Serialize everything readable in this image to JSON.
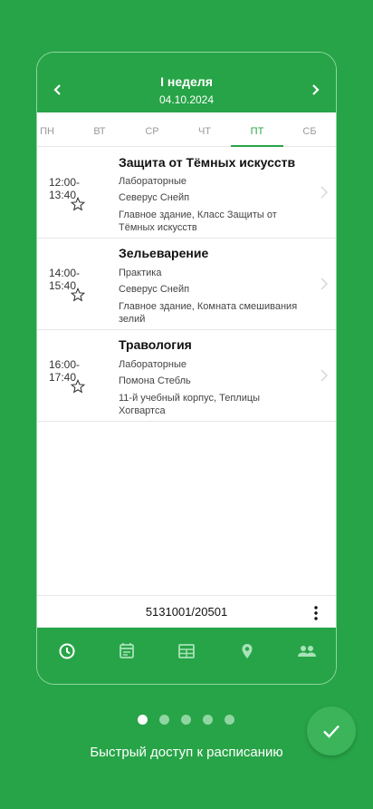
{
  "header": {
    "week_title": "I неделя",
    "date": "04.10.2024"
  },
  "days": [
    {
      "label": "ПН",
      "active": false
    },
    {
      "label": "ВТ",
      "active": false
    },
    {
      "label": "СР",
      "active": false
    },
    {
      "label": "ЧТ",
      "active": false
    },
    {
      "label": "ПТ",
      "active": true
    },
    {
      "label": "СБ",
      "active": false
    }
  ],
  "lessons": [
    {
      "time": "12:00-13:40",
      "subject": "Защита от Тёмных искусств",
      "type": "Лабораторные",
      "teacher": "Северус Снейп",
      "location": "Главное здание, Класс Защиты от Тёмных искусств"
    },
    {
      "time": "14:00-15:40",
      "subject": "Зельеварение",
      "type": "Практика",
      "teacher": "Северус Снейп",
      "location": "Главное здание, Комната смешивания зелий"
    },
    {
      "time": "16:00-17:40",
      "subject": "Травология",
      "type": "Лабораторные",
      "teacher": "Помона Стебль",
      "location": "11-й учебный корпус, Теплицы Хогвартса"
    }
  ],
  "group_code": "5131001/20501",
  "tabs": [
    {
      "icon": "clock-icon",
      "active": true
    },
    {
      "icon": "calendar-icon",
      "active": false
    },
    {
      "icon": "table-icon",
      "active": false
    },
    {
      "icon": "map-pin-icon",
      "active": false
    },
    {
      "icon": "people-icon",
      "active": false
    }
  ],
  "onboarding": {
    "caption": "Быстрый доступ к расписанию",
    "page_count": 5,
    "active_page": 1
  },
  "colors": {
    "brand_green": "#27a447",
    "light_green": "#8fd6a2"
  }
}
